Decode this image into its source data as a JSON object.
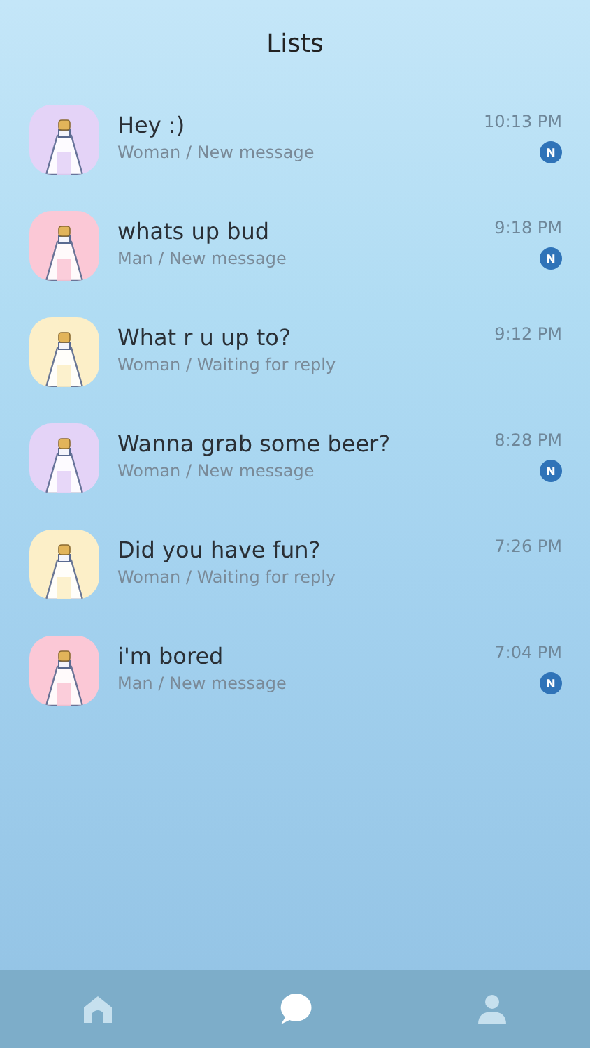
{
  "header": {
    "title": "Lists"
  },
  "messages": [
    {
      "title": "Hey :)",
      "subtitle": "Woman / New message",
      "time": "10:13 PM",
      "badge": "N",
      "color": "#e4d3f7"
    },
    {
      "title": "whats up bud",
      "subtitle": "Man / New message",
      "time": "9:18 PM",
      "badge": "N",
      "color": "#fbc8d6"
    },
    {
      "title": "What r u up to?",
      "subtitle": "Woman / Waiting for reply",
      "time": "9:12 PM",
      "color": "#fcefc8"
    },
    {
      "title": "Wanna grab some beer?",
      "subtitle": "Woman / New message",
      "time": "8:28 PM",
      "badge": "N",
      "color": "#e4d3f7"
    },
    {
      "title": "Did you have fun?",
      "subtitle": "Woman / Waiting for reply",
      "time": "7:26 PM",
      "color": "#fcefc8"
    },
    {
      "title": "i'm bored",
      "subtitle": "Man / New message",
      "time": "7:04 PM",
      "badge": "N",
      "color": "#fbc8d6"
    }
  ],
  "tabs": [
    {
      "kind": "home",
      "selected": false
    },
    {
      "kind": "chat",
      "selected": true
    },
    {
      "kind": "profile",
      "selected": false
    }
  ]
}
